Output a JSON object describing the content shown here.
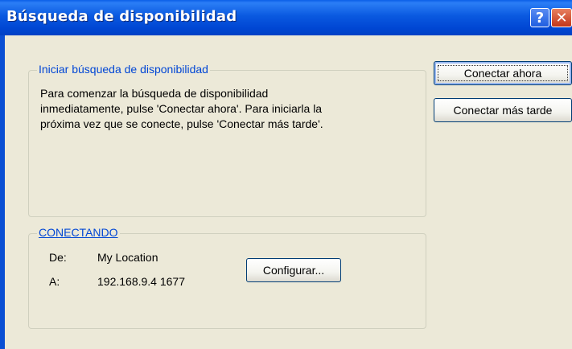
{
  "window": {
    "title": "Búsqueda de disponibilidad",
    "help_label": "?",
    "close_label": "✕"
  },
  "start_group": {
    "title": "Iniciar búsqueda de disponibilidad",
    "description": "Para comenzar la búsqueda de disponibilidad inmediatamente, pulse 'Conectar ahora'. Para iniciarla la próxima vez que se conecte, pulse 'Conectar más tarde'."
  },
  "connect_group": {
    "title": "CONECTANDO",
    "from_label": "De:",
    "from_value": "My Location",
    "to_label": "A:",
    "to_value": "192.168.9.4 1677",
    "configure_button": "Configurar..."
  },
  "buttons": {
    "connect_now": "Conectar ahora",
    "connect_later": "Conectar más tarde"
  },
  "colors": {
    "titlebar": "#0054e3",
    "group_title": "#0046d5",
    "background": "#ece9d8"
  }
}
